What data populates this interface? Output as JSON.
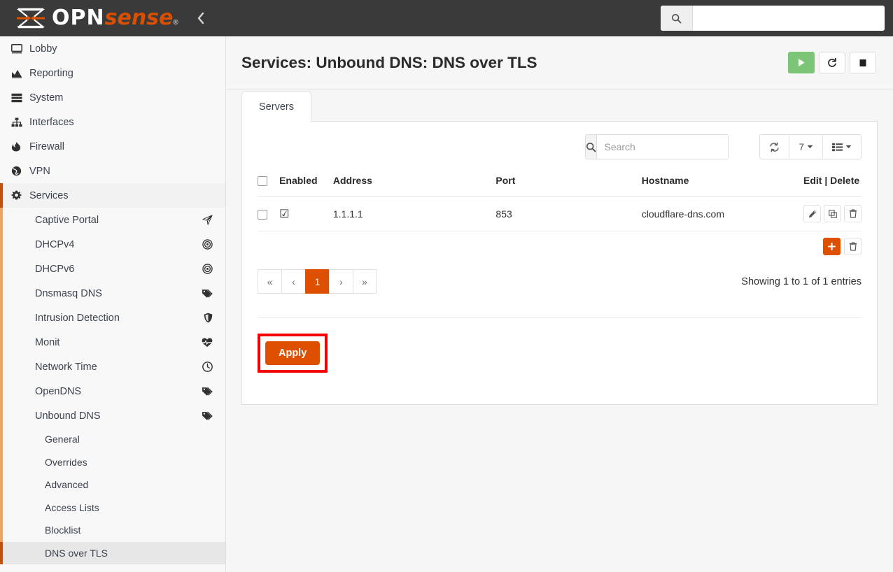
{
  "header": {
    "logo_primary": "OPN",
    "logo_secondary": "sense",
    "logo_registered": "®",
    "collapse_icon": "chevron-left-icon",
    "search_value": "",
    "search_placeholder": ""
  },
  "sidebar": {
    "top_items": [
      {
        "label": "Lobby",
        "icon": "monitor-icon"
      },
      {
        "label": "Reporting",
        "icon": "chart-area-icon"
      },
      {
        "label": "System",
        "icon": "server-icon"
      },
      {
        "label": "Interfaces",
        "icon": "sitemap-icon"
      },
      {
        "label": "Firewall",
        "icon": "fire-icon"
      },
      {
        "label": "VPN",
        "icon": "globe-icon"
      }
    ],
    "services": {
      "label": "Services",
      "icon": "gear-icon",
      "active": true
    },
    "service_items": [
      {
        "label": "Captive Portal",
        "icon": "paper-plane-icon"
      },
      {
        "label": "DHCPv4",
        "icon": "bullseye-icon"
      },
      {
        "label": "DHCPv6",
        "icon": "bullseye-icon"
      },
      {
        "label": "Dnsmasq DNS",
        "icon": "tags-icon"
      },
      {
        "label": "Intrusion Detection",
        "icon": "shield-icon"
      },
      {
        "label": "Monit",
        "icon": "heartbeat-icon"
      },
      {
        "label": "Network Time",
        "icon": "clock-icon"
      },
      {
        "label": "OpenDNS",
        "icon": "tags-icon"
      },
      {
        "label": "Unbound DNS",
        "icon": "tags-icon"
      }
    ],
    "unbound_items": [
      {
        "label": "General",
        "active": false
      },
      {
        "label": "Overrides",
        "active": false
      },
      {
        "label": "Advanced",
        "active": false
      },
      {
        "label": "Access Lists",
        "active": false
      },
      {
        "label": "Blocklist",
        "active": false
      },
      {
        "label": "DNS over TLS",
        "active": true
      }
    ]
  },
  "page": {
    "title": "Services: Unbound DNS: DNS over TLS",
    "service_actions": [
      {
        "name": "start-service-button",
        "icon": "play-icon"
      },
      {
        "name": "restart-service-button",
        "icon": "restart-icon"
      },
      {
        "name": "stop-service-button",
        "icon": "stop-icon"
      }
    ]
  },
  "tabs": [
    {
      "label": "Servers",
      "active": true
    }
  ],
  "toolbar": {
    "search_placeholder": "Search",
    "search_value": "",
    "search_icon": "search-icon",
    "reload_icon": "refresh-icon",
    "page_size": "7",
    "columns_icon": "list-icon"
  },
  "table": {
    "columns": [
      "",
      "Enabled",
      "Address",
      "Port",
      "Hostname",
      "Edit | Delete"
    ],
    "rows": [
      {
        "selected": false,
        "enabled": "☑",
        "address": "1.1.1.1",
        "port": "853",
        "hostname": "cloudflare-dns.com",
        "actions": [
          "pencil-icon",
          "clone-icon",
          "trash-icon"
        ]
      }
    ],
    "footer_actions": [
      {
        "name": "add-row-button",
        "icon": "plus-icon",
        "label": "+"
      },
      {
        "name": "delete-selected-button",
        "icon": "trash-icon"
      }
    ]
  },
  "pagination": {
    "first": "«",
    "prev": "‹",
    "pages": [
      "1"
    ],
    "current": "1",
    "next": "›",
    "last": "»",
    "entries_info": "Showing 1 to 1 of 1 entries"
  },
  "apply": {
    "label": "Apply",
    "highlight_color": "#f50000",
    "button_color": "#de5000"
  },
  "colors": {
    "brand_orange": "#d94f00",
    "accent_orange": "#de5000",
    "topbar": "#3a3a3a",
    "sidebar_bg": "#f8f8f8",
    "page_bg": "#f6f6f6",
    "service_start_green": "#7cc576"
  }
}
